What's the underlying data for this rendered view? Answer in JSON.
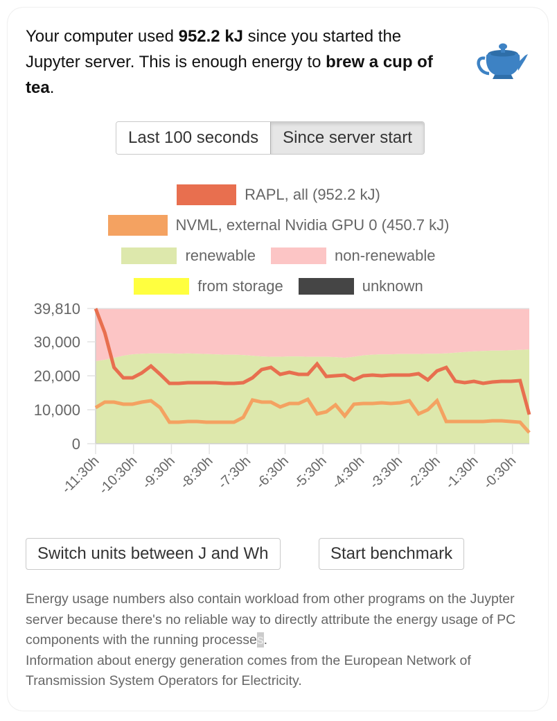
{
  "headline": {
    "prefix": "Your computer used ",
    "energy": "952.2 kJ",
    "middle": " since you started the Jupyter server. This is enough energy to ",
    "comparison": "brew a cup of tea",
    "suffix": ".",
    "icon": "teapot-icon"
  },
  "range_toggle": {
    "options": [
      "Last 100 seconds",
      "Since server start"
    ],
    "selected": "Since server start"
  },
  "colors": {
    "rapl": "#e86f4f",
    "nvml": "#f4a261",
    "renewable": "#dde8ac",
    "non_renewable": "#fcc5c5",
    "from_storage": "#ffff3f",
    "unknown": "#454545",
    "grid": "#e2e2e2",
    "axis_text": "#666666"
  },
  "chart_data": {
    "type": "line",
    "title": "",
    "xlabel": "",
    "ylabel": "",
    "ylim": [
      0,
      39810
    ],
    "yticks": [
      "0",
      "10,000",
      "20,000",
      "30,000",
      "39,810"
    ],
    "ytick_values": [
      0,
      10000,
      20000,
      30000,
      39810
    ],
    "xticks": [
      "-11:30h",
      "-10:30h",
      "-9:30h",
      "-8:30h",
      "-7:30h",
      "-6:30h",
      "-5:30h",
      "-4:30h",
      "-3:30h",
      "-2:30h",
      "-1:30h",
      "-0:30h"
    ],
    "x_range_hours": [
      -11.5,
      -0.0
    ],
    "legend": [
      {
        "label": "RAPL, all (952.2 kJ)",
        "key": "rapl"
      },
      {
        "label": "NVML, external Nvidia GPU 0 (450.7 kJ)",
        "key": "nvml"
      },
      {
        "label": "renewable",
        "key": "renewable"
      },
      {
        "label": "non-renewable",
        "key": "non_renewable"
      },
      {
        "label": "from storage",
        "key": "from_storage"
      },
      {
        "label": "unknown",
        "key": "unknown"
      }
    ],
    "legend_position": "top",
    "grid": true,
    "series": [
      {
        "name": "RAPL, all",
        "type": "line",
        "values": [
          39810,
          32660,
          22460,
          19390,
          19390,
          20820,
          22860,
          20410,
          17760,
          17760,
          17960,
          17960,
          17960,
          17960,
          17760,
          17760,
          17960,
          19390,
          21840,
          22460,
          20410,
          21030,
          20410,
          20410,
          23480,
          19800,
          20010,
          20210,
          18780,
          20010,
          20210,
          20010,
          20210,
          20210,
          20210,
          20620,
          18780,
          21440,
          22460,
          18370,
          17960,
          18370,
          17760,
          18170,
          18370,
          18370,
          18580,
          8570
        ]
      },
      {
        "name": "NVML, external Nvidia GPU 0",
        "type": "line",
        "values": [
          10620,
          12250,
          12250,
          11640,
          11640,
          12250,
          12660,
          10620,
          6330,
          6330,
          6530,
          6530,
          6330,
          6330,
          6330,
          6330,
          7760,
          12860,
          12250,
          12250,
          10820,
          11840,
          11840,
          13070,
          8780,
          9390,
          11430,
          8170,
          11640,
          11840,
          11840,
          12050,
          11840,
          12050,
          12660,
          8780,
          10000,
          12660,
          6530,
          6530,
          6530,
          6530,
          6530,
          6740,
          6740,
          6530,
          6330,
          3270
        ]
      },
      {
        "name": "renewable",
        "type": "area",
        "values": [
          24300,
          24700,
          25300,
          25900,
          26300,
          26500,
          26600,
          26600,
          26600,
          26500,
          26600,
          26500,
          26400,
          26300,
          26200,
          26200,
          26100,
          25900,
          25700,
          25600,
          25600,
          25700,
          25700,
          25600,
          25600,
          25600,
          25500,
          25300,
          25600,
          26000,
          26200,
          26300,
          26300,
          26400,
          26400,
          26400,
          26500,
          26500,
          26600,
          26800,
          27000,
          27200,
          27300,
          27400,
          27400,
          27500,
          27600,
          27760
        ]
      },
      {
        "name": "non-renewable",
        "type": "area",
        "values": [
          39810,
          39810,
          39810,
          39810,
          39810,
          39810,
          39810,
          39810,
          39810,
          39810,
          39810,
          39810,
          39810,
          39810,
          39810,
          39810,
          39810,
          39810,
          39810,
          39810,
          39810,
          39810,
          39810,
          39810,
          39810,
          39810,
          39810,
          39810,
          39810,
          39810,
          39810,
          39810,
          39810,
          39810,
          39810,
          39810,
          39810,
          39810,
          39810,
          39810,
          39810,
          39810,
          39810,
          39810,
          39810,
          39810,
          39810,
          39810
        ]
      }
    ]
  },
  "buttons": {
    "switch_units": "Switch units between J and Wh",
    "benchmark": "Start benchmark"
  },
  "footer": {
    "line1_main": "Energy usage numbers also contain workload from other programs on the Juypter server because there's no reliable way to directly attribute the energy usage of PC components with the running processe",
    "line1_selected": "s",
    "line1_end": ".",
    "line2": "Information about energy generation comes from the European Network of Transmission System Operators for Electricity."
  }
}
